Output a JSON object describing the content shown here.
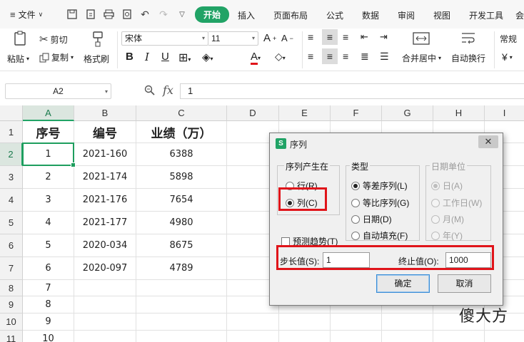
{
  "menu": {
    "file": "文件",
    "tabs": [
      "开始",
      "插入",
      "页面布局",
      "公式",
      "数据",
      "审阅",
      "视图",
      "开发工具",
      "会"
    ]
  },
  "ribbon": {
    "paste": "粘贴",
    "cut": "剪切",
    "copy": "复制",
    "format_painter": "格式刷",
    "font_name": "宋体",
    "font_size": "11",
    "merge": "合并居中",
    "wrap": "自动换行",
    "number_format": "常规",
    "currency": "¥"
  },
  "formula_bar": {
    "name_box": "A2",
    "fx": "fx",
    "value": "1"
  },
  "sheet": {
    "columns": [
      "A",
      "B",
      "C",
      "D",
      "E",
      "F",
      "G",
      "H",
      "I"
    ],
    "rows": [
      "1",
      "2",
      "3",
      "4",
      "5",
      "6",
      "7",
      "8",
      "9",
      "10",
      "11"
    ],
    "header": [
      "序号",
      "编号",
      "业绩（万）"
    ],
    "data": [
      [
        "1",
        "2021-160",
        "6388"
      ],
      [
        "2",
        "2021-174",
        "5898"
      ],
      [
        "3",
        "2021-176",
        "7654"
      ],
      [
        "4",
        "2021-177",
        "4980"
      ],
      [
        "5",
        "2020-034",
        "8675"
      ],
      [
        "6",
        "2020-097",
        "4789"
      ],
      [
        "7",
        "",
        ""
      ],
      [
        "8",
        "",
        ""
      ],
      [
        "9",
        "",
        ""
      ],
      [
        "10",
        "",
        ""
      ]
    ]
  },
  "dialog": {
    "title": "序列",
    "series_in": {
      "label": "序列产生在",
      "options": [
        "行(R)",
        "列(C)"
      ],
      "selected": "列(C)"
    },
    "type": {
      "label": "类型",
      "options": [
        "等差序列(L)",
        "等比序列(G)",
        "日期(D)",
        "自动填充(F)"
      ],
      "selected": "等差序列(L)"
    },
    "date_unit": {
      "label": "日期单位",
      "options": [
        "日(A)",
        "工作日(W)",
        "月(M)",
        "年(Y)"
      ],
      "selected": "日(A)"
    },
    "trend": "预测趋势(T)",
    "step_label": "步长值(S):",
    "step_value": "1",
    "stop_label": "终止值(O):",
    "stop_value": "1000",
    "ok": "确定",
    "cancel": "取消"
  },
  "watermark": "傻大方"
}
